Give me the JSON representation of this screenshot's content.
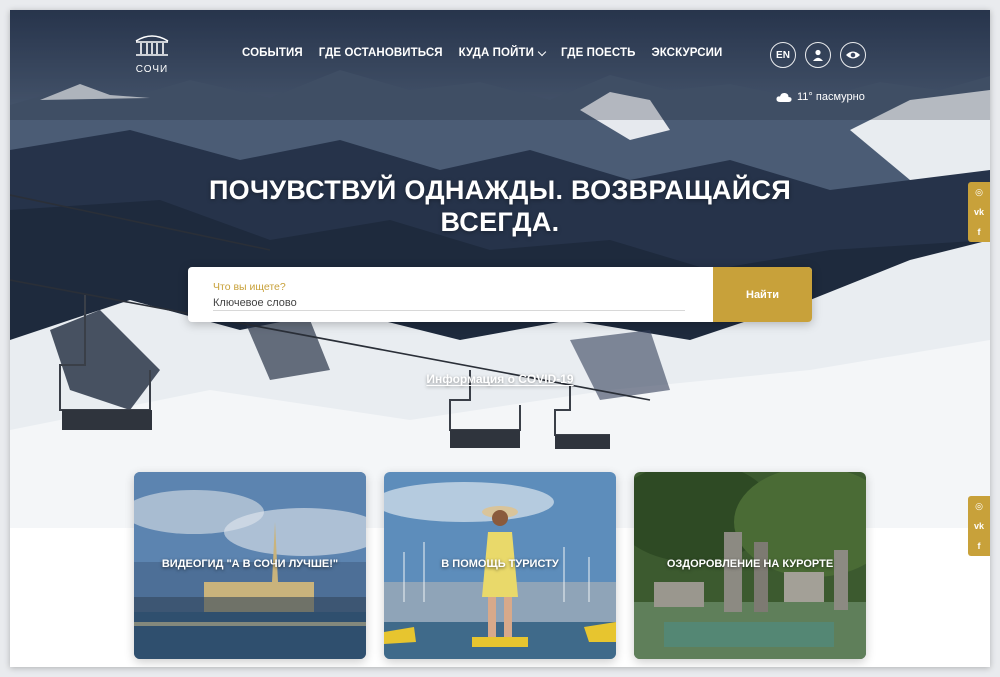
{
  "logo": {
    "text": "СОЧИ"
  },
  "nav": {
    "items": [
      {
        "label": "СОБЫТИЯ"
      },
      {
        "label": "ГДЕ ОСТАНОВИТЬСЯ"
      },
      {
        "label": "КУДА ПОЙТИ"
      },
      {
        "label": "ГДЕ ПОЕСТЬ"
      },
      {
        "label": "ЭКСКУРСИИ"
      }
    ]
  },
  "header": {
    "language_label": "EN",
    "profile_icon": "user-icon",
    "accessibility_icon": "eye-icon"
  },
  "weather": {
    "text": "11° пасмурно",
    "icon": "cloud-icon"
  },
  "hero": {
    "headline_line1": "ПОЧУВСТВУЙ ОДНАЖДЫ. ВОЗВРАЩАЙСЯ",
    "headline_line2": "ВСЕГДА."
  },
  "search": {
    "label": "Что вы ищете?",
    "placeholder": "Ключевое слово",
    "value": "",
    "button_label": "Найти"
  },
  "covid_link": "Информация о COVID-19",
  "social": {
    "icons": [
      "instagram-icon",
      "vk-icon",
      "facebook-icon"
    ],
    "glyphs": [
      "◎",
      "vk",
      "f"
    ]
  },
  "cards": [
    {
      "title": "ВИДЕОГИД \"А В СОЧИ ЛУЧШЕ!\""
    },
    {
      "title": "В ПОМОЩЬ ТУРИСТУ"
    },
    {
      "title": "ОЗДОРОВЛЕНИЕ НА КУРОРТЕ"
    }
  ],
  "colors": {
    "accent": "#c8a13a",
    "white": "#ffffff"
  }
}
